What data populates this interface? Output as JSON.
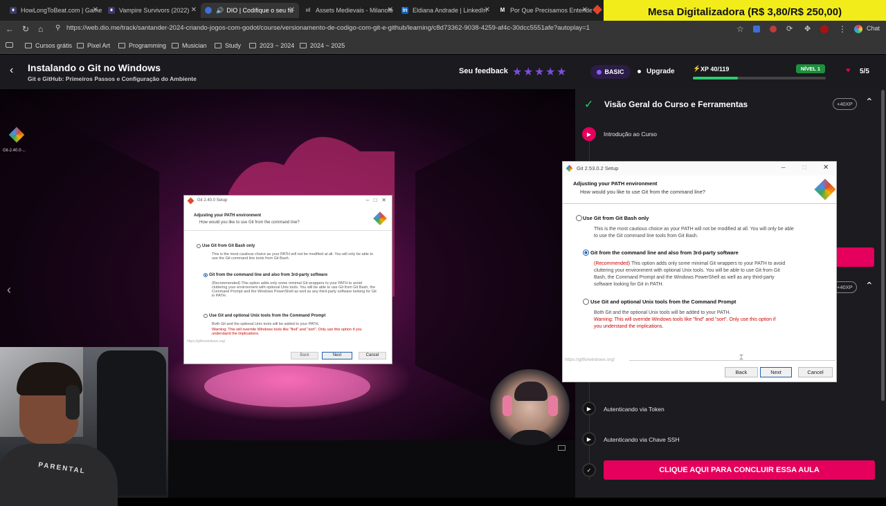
{
  "browser": {
    "tabs": [
      {
        "label": "HowLongToBeat.com | Game",
        "icon": "hltb-icon"
      },
      {
        "label": "Vampire Survivors (2022)",
        "icon": "hltb-icon"
      },
      {
        "label": "DIO | Codifique o seu fu",
        "icon": "dio-icon",
        "active": true
      },
      {
        "label": "Assets Medievais - Milanote",
        "icon": "milanote-icon"
      },
      {
        "label": "Eldiana Andrade | LinkedIn",
        "icon": "linkedin-icon"
      },
      {
        "label": "Por Que Precisamos Entende",
        "icon": "medium-icon"
      }
    ],
    "url": "https://web.dio.me/track/santander-2024-criando-jogos-com-godot/course/versionamento-de-codigo-com-git-e-github/learning/c8d73362-9038-4259-af4c-30dcc5551afe?autoplay=1",
    "chat_label": "Chat",
    "bookmarks": [
      "Cursos grátis",
      "Pixel Art",
      "Programming",
      "Musician",
      "Study",
      "2023 ~ 2024",
      "2024 ~ 2025"
    ]
  },
  "overlay_banner": "Mesa Digitalizadora (R$ 3,80/R$ 250,00)",
  "lesson": {
    "title": "Instalando o Git no Windows",
    "subtitle": "Git e GitHub: Primeiros Passos e Configuração do Ambiente",
    "feedback_label": "Seu feedback",
    "rating_stars": 5
  },
  "account": {
    "plan": "BASIC",
    "upgrade": "Upgrade",
    "xp": "XP 40/119",
    "xp_fraction": 0.336,
    "level": "NÍVEL 1",
    "lives": "5/5"
  },
  "sidebar": {
    "section_title": "Visão Geral do Curso e Ferramentas",
    "section_xp": "+40XP",
    "second_xp": "+40XP",
    "items": [
      "Introdução ao Curso",
      "Autenticando via Token",
      "Autenticando via Chave SSH"
    ],
    "cta": "CLIQUE AQUI PARA CONCLUIR ESSA AULA"
  },
  "video_dialog": {
    "title": "Git 2.40.0 Setup",
    "desktop_icon_label": "Git-2.40.0-...",
    "heading": "Adjusting your PATH environment",
    "subheading": "How would you like to use Git from the command line?",
    "options": [
      {
        "label": "Use Git from Git Bash only",
        "desc": "This is the most cautious choice as your PATH will not be modified at all. You will only be able to use the Git command line tools from Git Bash."
      },
      {
        "label": "Git from the command line and also from 3rd-party software",
        "desc": "(Recommended) This option adds only some minimal Git wrappers to your PATH to avoid cluttering your environment with optional Unix tools. You will be able to use Git from Git Bash, the Command Prompt and the Windows PowerShell as well as any third-party software looking for Git in PATH."
      },
      {
        "label": "Use Git and optional Unix tools from the Command Prompt",
        "desc": "Both Git and the optional Unix tools will be added to your PATH.",
        "warning": "Warning: This will override Windows tools like \"find\" and \"sort\". Only use this option if you understand the implications."
      }
    ],
    "footer_link": "https://gitforwindows.org/",
    "back": "Back",
    "next": "Next",
    "cancel": "Cancel"
  },
  "setup_dialog": {
    "title": "Git 2.53.0.2 Setup",
    "heading": "Adjusting your PATH environment",
    "subheading": "How would you like to use Git from the command line?",
    "options": [
      {
        "label": "Use Git from Git Bash only",
        "desc": "This is the most cautious choice as your PATH will not be modified at all. You will only be able to use the Git command line tools from Git Bash."
      },
      {
        "label": "Git from the command line and also from 3rd-party software",
        "desc_red": "(Recommended)",
        "desc": " This option adds only some minimal Git wrappers to your PATH to avoid cluttering your environment with optional Unix tools. You will be able to use Git from Git Bash, the Command Prompt and the Windows PowerShell as well as any third-party software looking for Git in PATH."
      },
      {
        "label": "Use Git and optional Unix tools from the Command Prompt",
        "desc": "Both Git and the optional Unix tools will be added to your PATH.",
        "warning": "Warning: This will override Windows tools like \"find\" and \"sort\". Only use this option if you understand the implications."
      }
    ],
    "selected_index": 1,
    "footer_link": "https://gitforwindows.org/",
    "back": "Back",
    "next": "Next",
    "cancel": "Cancel"
  },
  "webcam_shirt_text": "PARENTAL"
}
